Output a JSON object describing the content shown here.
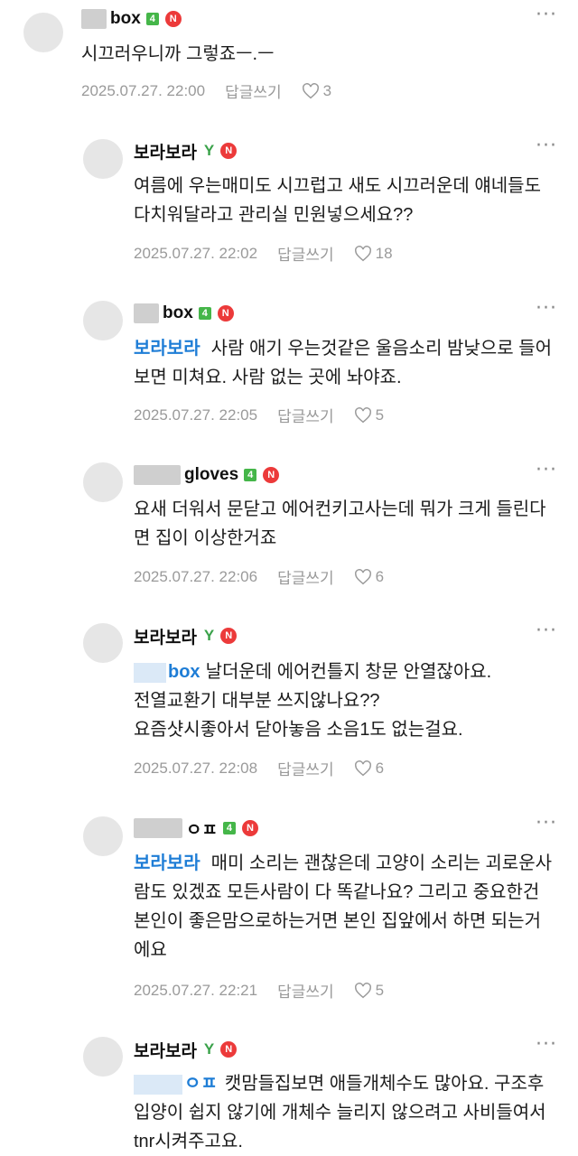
{
  "comments": [
    {
      "name": "box",
      "grade": "4",
      "body": "시끄러우니까 그렇죠ㅡ.ㅡ",
      "date": "2025.07.27. 22:00",
      "reply": "답글쓰기",
      "likes": "3"
    },
    {
      "name": "보라보라",
      "body": "여름에 우는매미도 시끄럽고 새도 시끄러운데 얘네들도 다치워달라고 관리실 민원넣으세요??",
      "date": "2025.07.27. 22:02",
      "reply": "답글쓰기",
      "likes": "18"
    },
    {
      "name": "box",
      "grade": "4",
      "mention": "보라보라",
      "body": "사람 애기 우는것같은 울음소리 밤낮으로 들어보면 미쳐요. 사람 없는 곳에 놔야죠.",
      "date": "2025.07.27. 22:05",
      "reply": "답글쓰기",
      "likes": "5"
    },
    {
      "name": "gloves",
      "grade": "4",
      "body": "요새 더워서 문닫고 에어컨키고사는데 뭐가 크게 들린다면 집이 이상한거죠",
      "date": "2025.07.27. 22:06",
      "reply": "답글쓰기",
      "likes": "6"
    },
    {
      "name": "보라보라",
      "mention": "box",
      "body_lines": [
        "날더운데 에어컨틀지 창문 안열잖아요.",
        "전열교환기 대부분 쓰지않나요??",
        "요즘샷시좋아서 닫아놓음 소음1도 없는걸요."
      ],
      "date": "2025.07.27. 22:08",
      "reply": "답글쓰기",
      "likes": "6"
    },
    {
      "name": "ㅇㅍ",
      "grade": "4",
      "mention": "보라보라",
      "body": "매미 소리는 괜찮은데 고양이 소리는 괴로운사람도 있겠죠 모든사람이 다 똑같나요? 그리고 중요한건 본인이 좋은맘으로하는거면 본인 집앞에서 하면 되는거에요",
      "date": "2025.07.27. 22:21",
      "reply": "답글쓰기",
      "likes": "5"
    },
    {
      "name": "보라보라",
      "mention": "ㅇㅍ",
      "body": "캣맘들집보면 애들개체수도 많아요. 구조후입양이 쉽지 않기에 개체수 늘리지 않으려고 사비들여서 tnr시켜주고요."
    }
  ],
  "icons": {
    "more": "more-dots-icon",
    "like": "heart-outline-icon",
    "newbie": "sprout-icon",
    "naver": "n-badge-icon"
  },
  "colors": {
    "mention": "#1e7dd6",
    "badge": "#ec3a3a",
    "grade": "#45b649"
  }
}
